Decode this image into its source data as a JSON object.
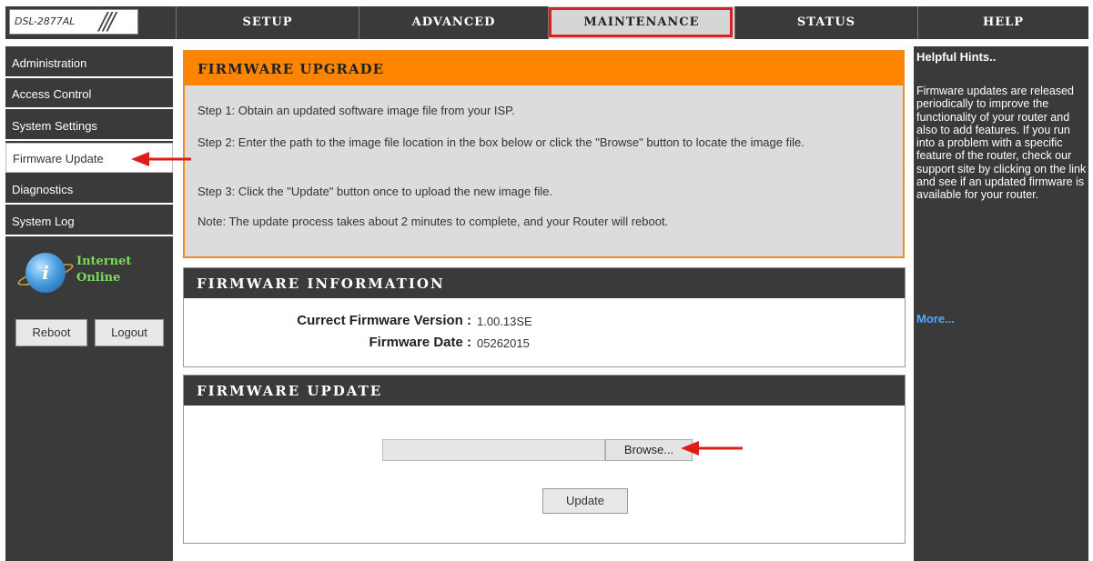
{
  "header": {
    "model": "DSL-2877AL",
    "tabs": [
      {
        "label": "SETUP"
      },
      {
        "label": "ADVANCED"
      },
      {
        "label": "MAINTENANCE"
      },
      {
        "label": "STATUS"
      },
      {
        "label": "HELP"
      }
    ],
    "active_tab": "MAINTENANCE"
  },
  "sidebar": {
    "items": [
      {
        "label": "Administration"
      },
      {
        "label": "Access Control"
      },
      {
        "label": "System Settings"
      },
      {
        "label": "Firmware Update"
      },
      {
        "label": "Diagnostics"
      },
      {
        "label": "System Log"
      }
    ],
    "active_item": "Firmware Update",
    "status": {
      "line1": "Internet",
      "line2": "Online"
    },
    "reboot_label": "Reboot",
    "logout_label": "Logout"
  },
  "upgrade": {
    "title": "FIRMWARE UPGRADE",
    "step1": "Step 1: Obtain an updated software image file from your ISP.",
    "step2": "Step 2: Enter the path to the image file location in the box below or click the \"Browse\" button to locate the image file.",
    "step3": "Step 3: Click the \"Update\" button once to upload the new image file.",
    "note": "Note: The update process takes about 2 minutes to complete, and your Router will reboot."
  },
  "info": {
    "title": "FIRMWARE INFORMATION",
    "version_label": "Currect Firmware Version :",
    "version_value": "1.00.13SE",
    "date_label": "Firmware Date :",
    "date_value": "05262015"
  },
  "update": {
    "title": "FIRMWARE UPDATE",
    "file_value": "",
    "browse_label": "Browse...",
    "update_label": "Update"
  },
  "help": {
    "title": "Helpful Hints..",
    "text": "Firmware updates are released periodically to improve the functionality of your router and also to add features. If you run into a problem with a specific feature of the router, check our support site by clicking on the link and see if an updated firmware is available for your router.",
    "more": "More..."
  },
  "colors": {
    "dark": "#3a3a3a",
    "orange": "#ff8400",
    "highlight_red": "#d8201f",
    "status_green": "#7dd85b",
    "link_blue": "#4ea8ff"
  }
}
